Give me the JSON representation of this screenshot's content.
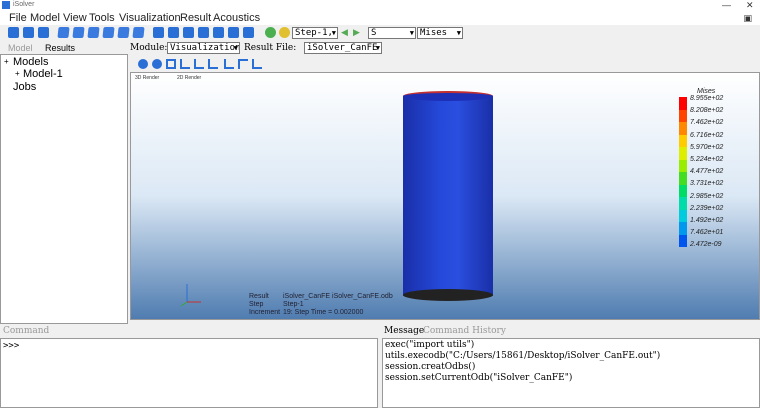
{
  "window": {
    "title": "iSolver"
  },
  "menu": [
    "File",
    "Model",
    "View",
    "Tools",
    "Visualization",
    "Result",
    "Acoustics"
  ],
  "toolbar": {
    "step_select": "Step-1, I",
    "field_select": "S",
    "component_select": "Mises"
  },
  "left_tabs": {
    "model": "Model",
    "results": "Results"
  },
  "tree": {
    "models": "Models",
    "model1": "Model-1",
    "jobs": "Jobs",
    "expander": "+"
  },
  "module_bar": {
    "module_label": "Module:",
    "module_value": "Visualization",
    "result_label": "Result File:",
    "result_value": "iSolver_CanFE"
  },
  "viewport": {
    "tabs": [
      "3D Render",
      "2D Render"
    ],
    "legend": {
      "title": "Mises",
      "values": [
        "8.955e+02",
        "8.208e+02",
        "7.462e+02",
        "6.716e+02",
        "5.970e+02",
        "5.224e+02",
        "4.477e+02",
        "3.731e+02",
        "2.985e+02",
        "2.239e+02",
        "1.492e+02",
        "7.462e+01",
        "2.472e-09"
      ],
      "colors": [
        "#ff0000",
        "#ff4400",
        "#ff8800",
        "#ffcc00",
        "#ddee00",
        "#99ee00",
        "#44dd22",
        "#00dd66",
        "#00ddaa",
        "#00ccdd",
        "#0099ee",
        "#0055ee",
        "#0022dd"
      ]
    },
    "info": {
      "result_key": "Result",
      "result_value": "iSolver_CanFE    iSolver_CanFE.odb",
      "step_key": "Step",
      "step_value": "Step-1",
      "increment_key": "Increment",
      "increment_value": "19: Step Time =  0.002000"
    }
  },
  "bottom": {
    "command_tab": "Command",
    "prompt": ">>>",
    "message_tab": "Message",
    "history_tab": "Command History",
    "messages": [
      "exec(\"import utils\")",
      "utils.execodb(\"C:/Users/15861/Desktop/iSolver_CanFE.out\")",
      "session.creatOdbs()",
      "session.setCurrentOdb(\"iSolver_CanFE\")"
    ]
  }
}
